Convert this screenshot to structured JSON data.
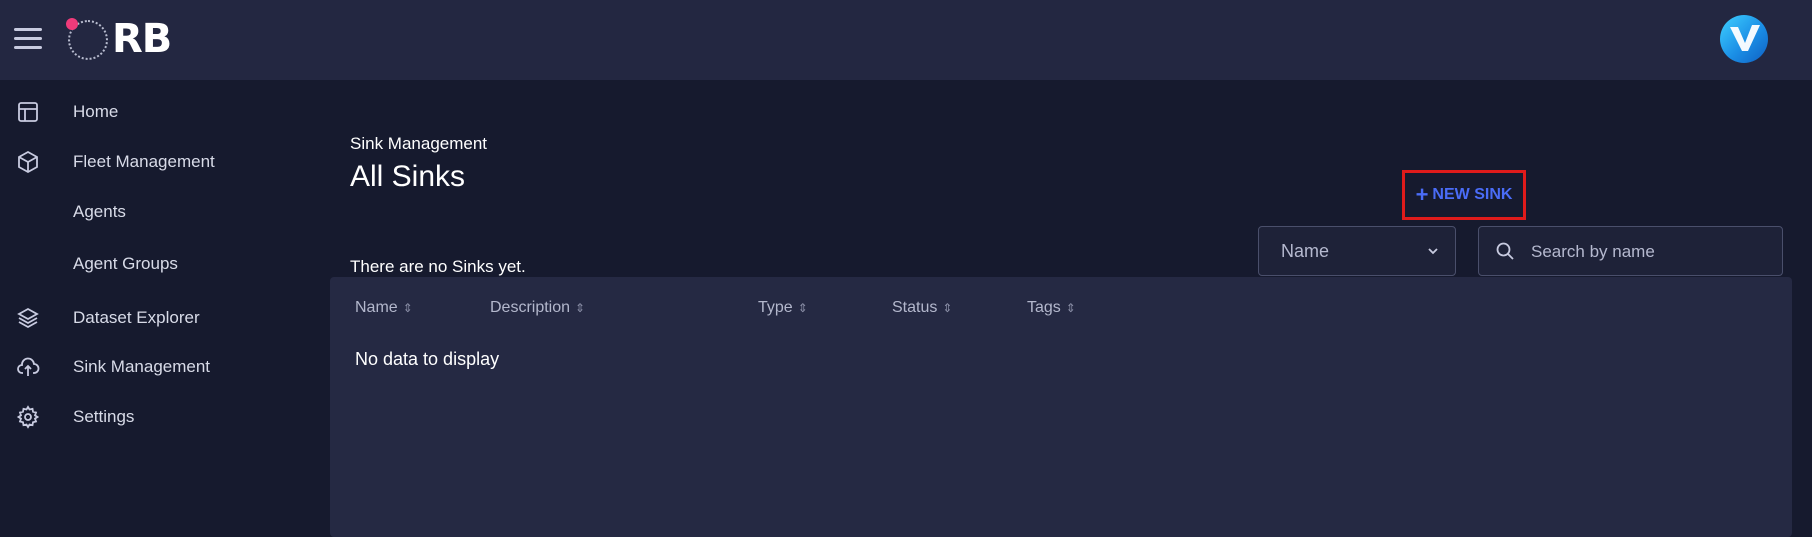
{
  "header": {
    "logo_text": "RB",
    "menu_icon": "hamburger-menu-icon",
    "avatar_icon": "user-avatar-icon"
  },
  "sidebar": {
    "items": [
      {
        "label": "Home",
        "icon": "layout-icon"
      },
      {
        "label": "Fleet Management",
        "icon": "cube-icon"
      },
      {
        "label": "Agents",
        "icon": ""
      },
      {
        "label": "Agent Groups",
        "icon": ""
      },
      {
        "label": "Dataset Explorer",
        "icon": "layers-icon"
      },
      {
        "label": "Sink Management",
        "icon": "cloud-upload-icon"
      },
      {
        "label": "Settings",
        "icon": "gear-icon"
      }
    ]
  },
  "page": {
    "breadcrumb": "Sink Management",
    "title": "All Sinks",
    "empty_message": "There are no Sinks yet."
  },
  "filters": {
    "select_value": "Name",
    "search_placeholder": "Search by name"
  },
  "table": {
    "columns": [
      "Name",
      "Description",
      "Type",
      "Status",
      "Tags"
    ],
    "no_data": "No data to display"
  },
  "actions": {
    "new_sink_label": "NEW SINK",
    "new_sink_icon": "plus-icon"
  },
  "colors": {
    "accent": "#4a6cf7",
    "highlight_border": "#e01b1b",
    "background": "#161a2e",
    "topbar": "#232741",
    "card": "#252943"
  }
}
